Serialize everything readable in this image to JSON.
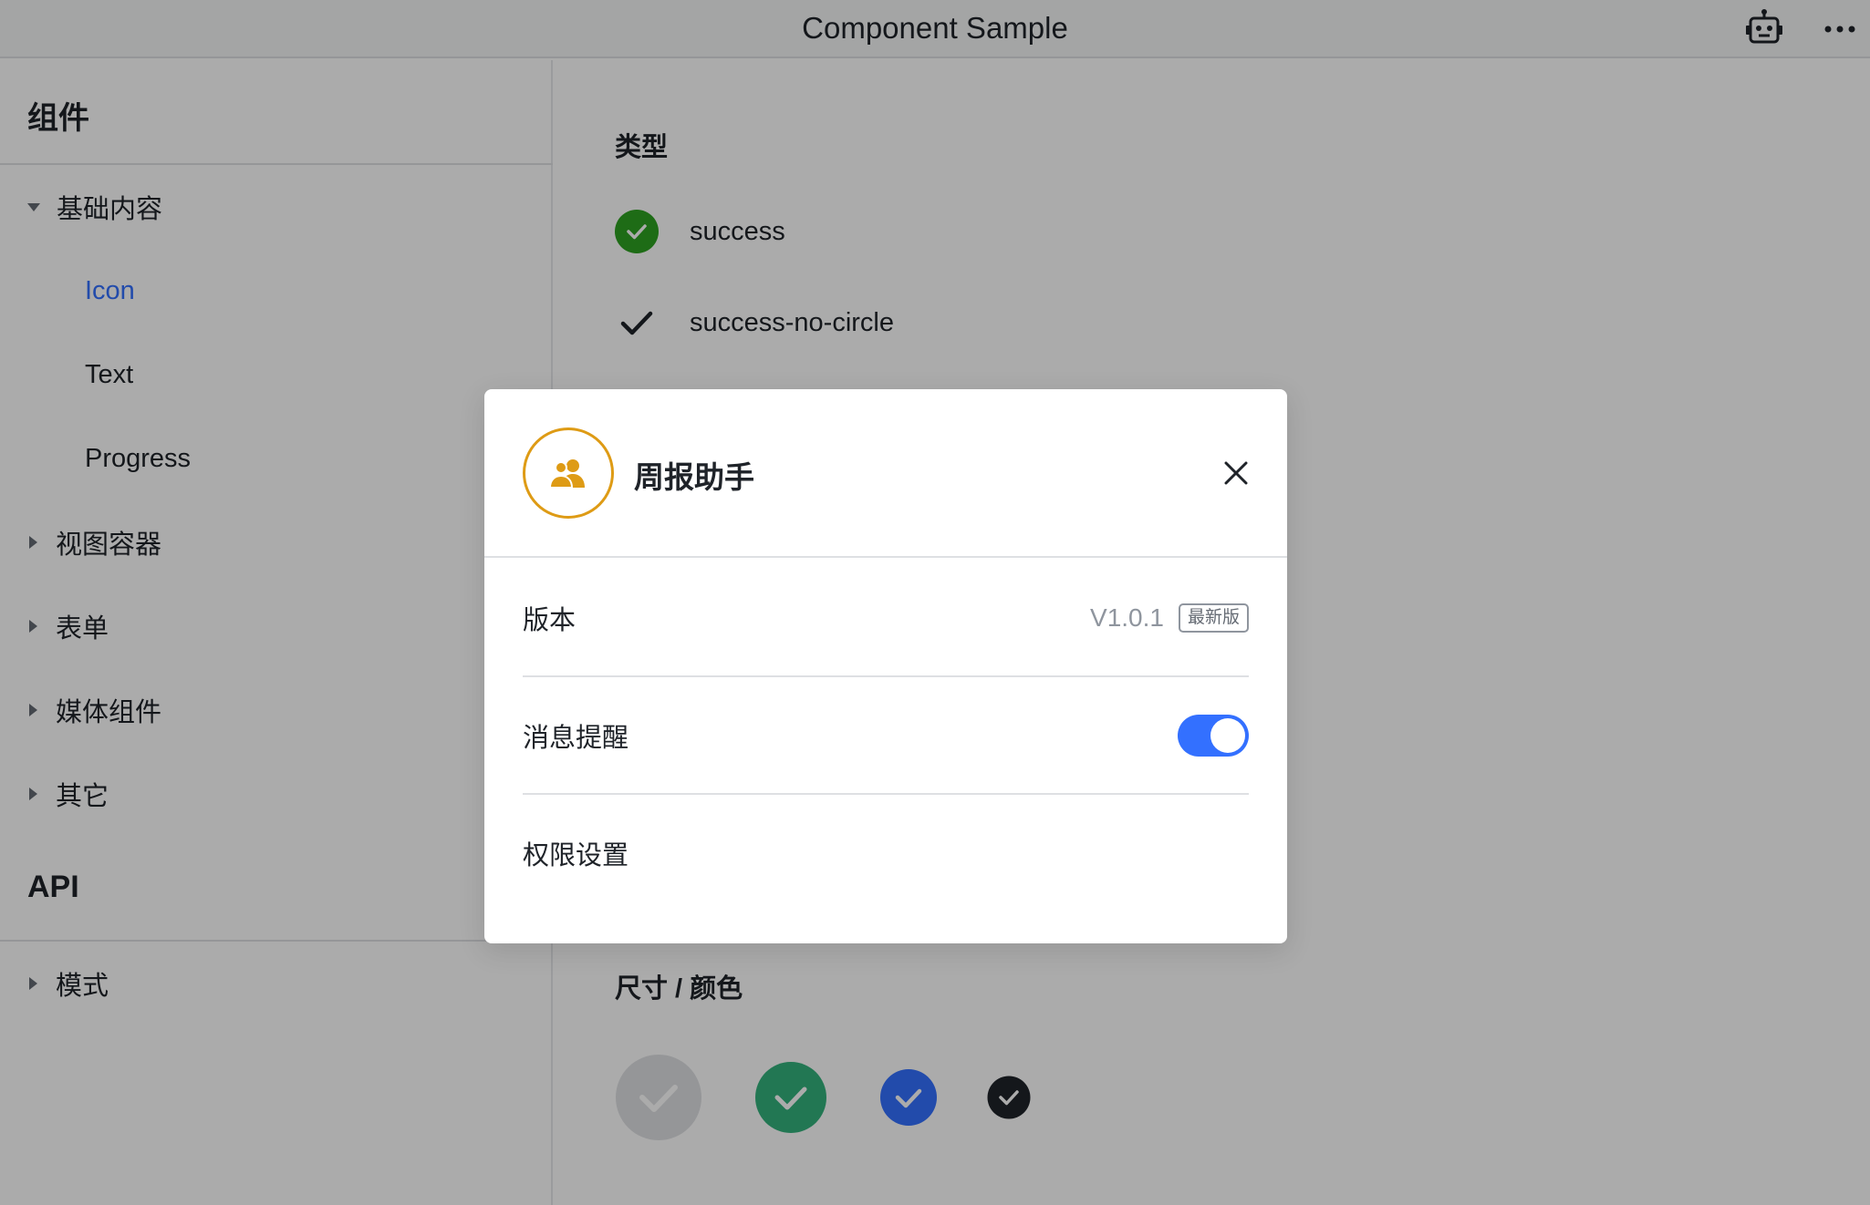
{
  "window": {
    "title": "Component Sample",
    "icons": [
      "robot-icon",
      "more-icon"
    ]
  },
  "sidebar": {
    "components_title": "组件",
    "groups": [
      {
        "label": "基础内容",
        "expanded": true,
        "items": [
          "Icon",
          "Text",
          "Progress"
        ],
        "active_item": "Icon"
      },
      {
        "label": "视图容器",
        "expanded": false
      },
      {
        "label": "表单",
        "expanded": false
      },
      {
        "label": "媒体组件",
        "expanded": false
      },
      {
        "label": "其它",
        "expanded": false
      }
    ],
    "api_title": "API",
    "api_groups": [
      {
        "label": "模式",
        "expanded": false
      }
    ]
  },
  "main": {
    "type_heading": "类型",
    "types": [
      {
        "label": "success",
        "icon": "success-circle-icon"
      },
      {
        "label": "success-no-circle",
        "icon": "success-no-circle-icon"
      }
    ],
    "size_color_heading": "尺寸 / 颜色",
    "size_color_icons": [
      {
        "icon": "success-circle-icon",
        "color": "#dee0e3"
      },
      {
        "icon": "success-circle-icon",
        "color": "#34b27d"
      },
      {
        "icon": "success-circle-icon",
        "color": "#3370ff"
      },
      {
        "icon": "success-circle-icon",
        "color": "#1f2329"
      }
    ]
  },
  "modal": {
    "title": "周报助手",
    "avatar_icon": "users-icon",
    "rows": [
      {
        "label": "版本",
        "value": "V1.0.1",
        "badge": "最新版"
      },
      {
        "label": "消息提醒",
        "toggle_on": true
      },
      {
        "label": "权限设置"
      }
    ]
  },
  "colors": {
    "accent": "#3370ff",
    "avatar_ring": "#de9b15",
    "success_green": "#2ea121",
    "mask": "rgba(0,0,0,0.33)"
  }
}
